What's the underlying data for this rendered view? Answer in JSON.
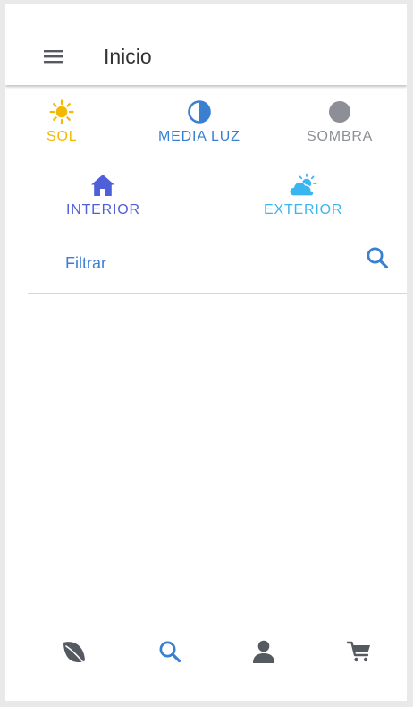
{
  "header": {
    "title": "Inicio",
    "menu_icon": "hamburger-menu-icon"
  },
  "light_options": [
    {
      "label": "SOL",
      "icon": "sun-icon",
      "color": "#f5b800"
    },
    {
      "label": "MEDIA LUZ",
      "icon": "half-circle-icon",
      "color": "#3b7fd1"
    },
    {
      "label": "SOMBRA",
      "icon": "circle-icon",
      "color": "#8c8f95"
    }
  ],
  "location_options": [
    {
      "label": "INTERIOR",
      "icon": "house-icon",
      "color": "#4f5fd8"
    },
    {
      "label": "EXTERIOR",
      "icon": "cloud-sun-icon",
      "color": "#3ab5ef"
    }
  ],
  "filter": {
    "placeholder": "Filtrar",
    "search_icon": "search-icon",
    "accent": "#3b7fd1"
  },
  "bottom_nav": [
    {
      "icon": "leaf-icon",
      "color": "#555a60"
    },
    {
      "icon": "search-icon",
      "color": "#3b7fd1",
      "active": true
    },
    {
      "icon": "user-icon",
      "color": "#555a60"
    },
    {
      "icon": "cart-icon",
      "color": "#555a60"
    }
  ]
}
